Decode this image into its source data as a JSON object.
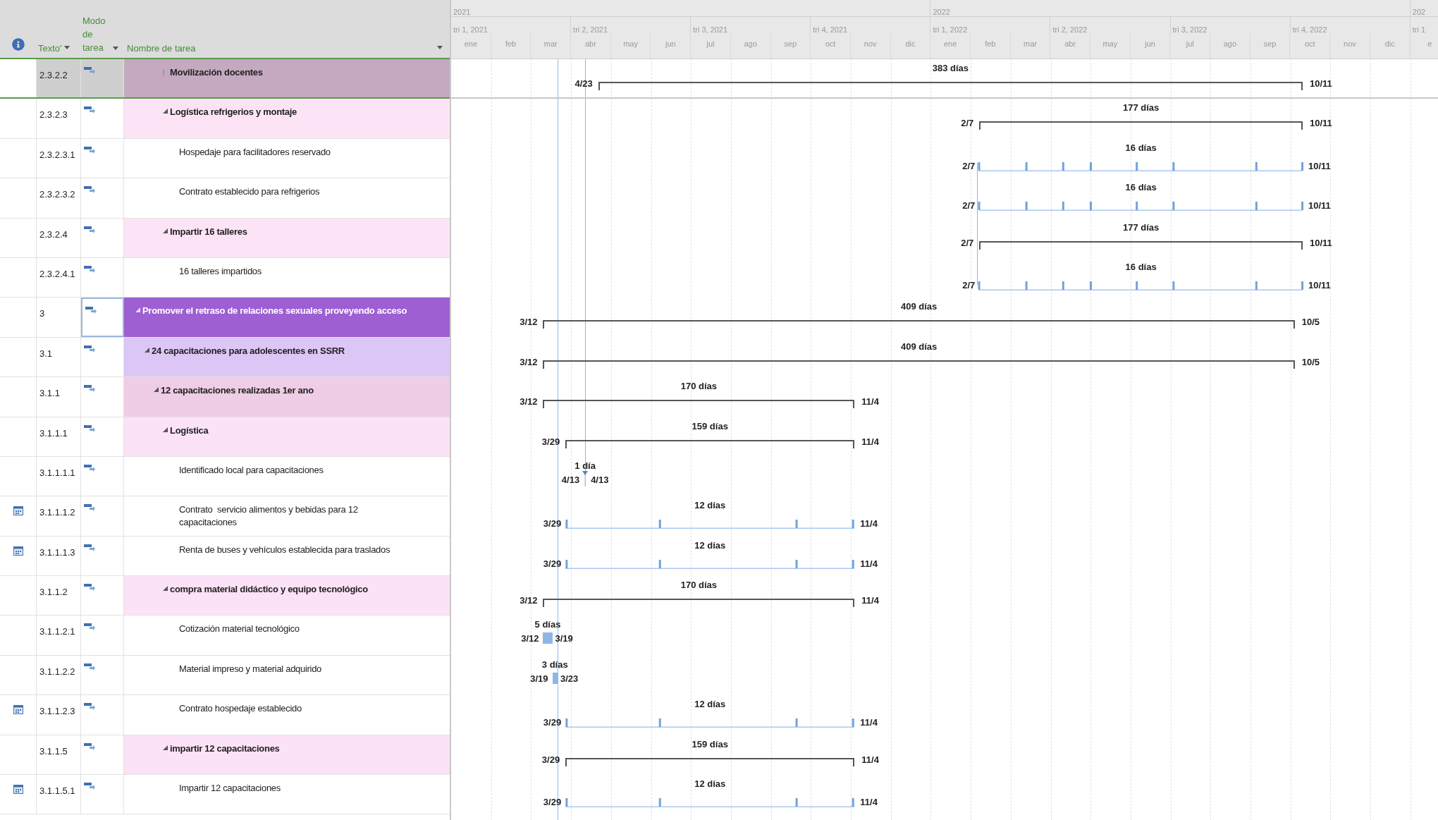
{
  "table": {
    "columns": [
      {
        "label": "Texto'"
      },
      {
        "label": "Modo de tarea"
      },
      {
        "label": "Nombre de tarea"
      }
    ],
    "rows": [
      {
        "wbs": "2.3.2.2",
        "name": "Movilización docentes",
        "kind": "summary",
        "expanded": false,
        "selected": true,
        "cell_focus": false,
        "recurring_indicator": false,
        "color": "#c4a9c0",
        "bar": {
          "kind": "summary",
          "duration": "383 días",
          "start": "4/23",
          "finish": "10/11"
        }
      },
      {
        "wbs": "2.3.2.3",
        "name": "Logística refrigerios y montaje",
        "kind": "summary",
        "expanded": true,
        "selected": false,
        "cell_focus": false,
        "recurring_indicator": false,
        "color": "#fce4f6",
        "bar": {
          "kind": "summary",
          "duration": "177 días",
          "start": "2/7",
          "finish": "10/11"
        },
        "children": [
          {
            "wbs": "2.3.2.3.1",
            "name": "Hospedaje para facilitadores reservado",
            "kind": "task",
            "selected": false,
            "cell_focus": false,
            "recurring_indicator": false,
            "bar": {
              "kind": "recurring",
              "duration": "16 días",
              "start": "2/7",
              "finish": "10/11"
            }
          },
          {
            "wbs": "2.3.2.3.2",
            "name": "Contrato establecido para refrigerios",
            "kind": "task",
            "selected": false,
            "cell_focus": false,
            "recurring_indicator": false,
            "bar": {
              "kind": "recurring",
              "duration": "16 días",
              "start": "2/7",
              "finish": "10/11"
            }
          }
        ]
      },
      {
        "wbs": "2.3.2.4",
        "name": "Impartir 16 talleres",
        "kind": "summary",
        "expanded": true,
        "selected": false,
        "cell_focus": false,
        "recurring_indicator": false,
        "color": "#fce4f6",
        "bar": {
          "kind": "summary",
          "duration": "177 días",
          "start": "2/7",
          "finish": "10/11"
        },
        "children": [
          {
            "wbs": "2.3.2.4.1",
            "name": "16 talleres impartidos",
            "kind": "task",
            "selected": false,
            "cell_focus": false,
            "recurring_indicator": false,
            "bar": {
              "kind": "recurring",
              "duration": "16 días",
              "start": "2/7",
              "finish": "10/11"
            }
          }
        ]
      },
      {
        "wbs": "3",
        "name": "Promover el retraso de relaciones sexuales proveyendo acceso",
        "kind": "summary",
        "expanded": true,
        "selected": false,
        "cell_focus": true,
        "recurring_indicator": false,
        "color": "#9d5fd2",
        "bar": {
          "kind": "summary",
          "duration": "409 días",
          "start": "3/12",
          "finish": "10/5"
        },
        "children": [
          {
            "wbs": "3.1",
            "name": "24 capacitaciones para adolescentes en SSRR",
            "kind": "summary",
            "expanded": true,
            "selected": false,
            "cell_focus": false,
            "recurring_indicator": false,
            "color": "#dcc6f6",
            "bar": {
              "kind": "summary",
              "duration": "409 días",
              "start": "3/12",
              "finish": "10/5"
            },
            "children": [
              {
                "wbs": "3.1.1",
                "name": "12 capacitaciones realizadas 1er ano",
                "kind": "summary",
                "expanded": true,
                "selected": false,
                "cell_focus": false,
                "recurring_indicator": false,
                "color": "#efcde6",
                "bar": {
                  "kind": "summary",
                  "duration": "170 días",
                  "start": "3/12",
                  "finish": "11/4"
                },
                "children": [
                  {
                    "wbs": "3.1.1.1",
                    "name": "Logística",
                    "kind": "summary",
                    "expanded": true,
                    "selected": false,
                    "cell_focus": false,
                    "recurring_indicator": false,
                    "color": "#fce2f6",
                    "bar": {
                      "kind": "summary",
                      "duration": "159 días",
                      "start": "3/29",
                      "finish": "11/4"
                    },
                    "children": [
                      {
                        "wbs": "3.1.1.1.1",
                        "name": "Identificado local para capacitaciones",
                        "kind": "task",
                        "selected": false,
                        "cell_focus": false,
                        "recurring_indicator": false,
                        "bar": {
                          "kind": "milestone",
                          "duration": "1 día",
                          "start": "4/13",
                          "finish": "4/13"
                        }
                      },
                      {
                        "wbs": "3.1.1.1.2",
                        "name": "Contrato  servicio alimentos y bebidas para 12 capacitaciones",
                        "kind": "task",
                        "selected": false,
                        "cell_focus": false,
                        "recurring_indicator": true,
                        "bar": {
                          "kind": "recurring",
                          "duration": "12 días",
                          "start": "3/29",
                          "finish": "11/4"
                        }
                      },
                      {
                        "wbs": "3.1.1.1.3",
                        "name": "Renta de buses y vehículos establecida para traslados",
                        "kind": "task",
                        "selected": false,
                        "cell_focus": false,
                        "recurring_indicator": true,
                        "bar": {
                          "kind": "recurring",
                          "duration": "12 días",
                          "start": "3/29",
                          "finish": "11/4"
                        }
                      }
                    ]
                  },
                  {
                    "wbs": "3.1.1.2",
                    "name": "compra material didáctico y equipo tecnológico",
                    "kind": "summary",
                    "expanded": true,
                    "selected": false,
                    "cell_focus": false,
                    "recurring_indicator": false,
                    "color": "#fce2f6",
                    "bar": {
                      "kind": "summary",
                      "duration": "170 días",
                      "start": "3/12",
                      "finish": "11/4"
                    },
                    "children": [
                      {
                        "wbs": "3.1.1.2.1",
                        "name": "Cotización material tecnológico",
                        "kind": "task",
                        "selected": false,
                        "cell_focus": false,
                        "recurring_indicator": false,
                        "bar": {
                          "kind": "task",
                          "duration": "5 días",
                          "start": "3/12",
                          "finish": "3/19"
                        }
                      },
                      {
                        "wbs": "3.1.1.2.2",
                        "name": "Material impreso y material adquirido",
                        "kind": "task",
                        "selected": false,
                        "cell_focus": false,
                        "recurring_indicator": false,
                        "bar": {
                          "kind": "task",
                          "duration": "3 días",
                          "start": "3/19",
                          "finish": "3/23"
                        }
                      },
                      {
                        "wbs": "3.1.1.2.3",
                        "name": "Contrato hospedaje establecido",
                        "kind": "task",
                        "selected": false,
                        "cell_focus": false,
                        "recurring_indicator": true,
                        "bar": {
                          "kind": "recurring",
                          "duration": "12 días",
                          "start": "3/29",
                          "finish": "11/4"
                        }
                      }
                    ]
                  },
                  {
                    "wbs": "3.1.1.5",
                    "name": "impartir 12 capacitaciones",
                    "kind": "summary",
                    "expanded": true,
                    "selected": false,
                    "cell_focus": false,
                    "recurring_indicator": false,
                    "color": "#fce2f6",
                    "bar": {
                      "kind": "summary",
                      "duration": "159 días",
                      "start": "3/29",
                      "finish": "11/4"
                    },
                    "children": [
                      {
                        "wbs": "3.1.1.5.1",
                        "name": "Impartir 12 capacitaciones",
                        "kind": "task",
                        "selected": false,
                        "cell_focus": false,
                        "recurring_indicator": true,
                        "bar": {
                          "kind": "recurring",
                          "duration": "12 días",
                          "start": "3/29",
                          "finish": "11/4"
                        }
                      }
                    ]
                  }
                ]
              }
            ]
          }
        ]
      }
    ]
  },
  "timeline": {
    "years": [
      "2021",
      "2022",
      "202"
    ],
    "quarters": [
      "tri 1, 2021",
      "tri 2, 2021",
      "tri 3, 2021",
      "tri 4, 2021",
      "tri 1, 2022",
      "tri 2, 2022",
      "tri 3, 2022",
      "tri 4, 2022",
      "tri 1"
    ],
    "months": [
      "ene",
      "feb",
      "mar",
      "abr",
      "may",
      "jun",
      "jul",
      "ago",
      "sep",
      "oct",
      "nov",
      "dic",
      "ene",
      "feb",
      "mar",
      "abr",
      "may",
      "jun",
      "jul",
      "ago",
      "sep",
      "oct",
      "nov",
      "dic",
      "e"
    ]
  }
}
